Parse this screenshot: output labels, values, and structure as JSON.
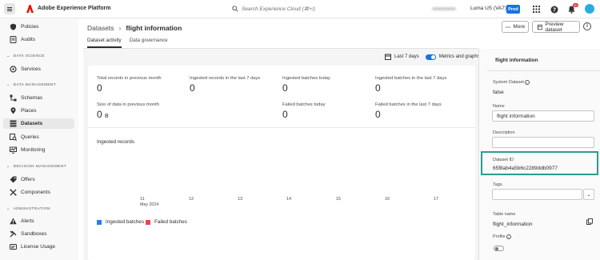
{
  "app": {
    "title": "Adobe Experience Platform"
  },
  "topbar": {
    "search_placeholder": "Search Experience Cloud (⌘+/)",
    "org": "Luma US (VA7)",
    "env_badge": "Prod",
    "notification_count": "9+",
    "colors": {
      "accent": "#1473e6",
      "badge": "#d7373f",
      "avatar": "#29abe2"
    }
  },
  "sidebar": {
    "items_top": [
      {
        "label": "Policies",
        "icon": "policies-icon"
      },
      {
        "label": "Audits",
        "icon": "audits-icon"
      }
    ],
    "sections": [
      {
        "title": "DATA SCIENCE",
        "items": [
          {
            "label": "Services",
            "icon": "services-icon"
          }
        ]
      },
      {
        "title": "DATA MANAGEMENT",
        "items": [
          {
            "label": "Schemas",
            "icon": "schemas-icon"
          },
          {
            "label": "Places",
            "icon": "places-icon"
          },
          {
            "label": "Datasets",
            "icon": "datasets-icon",
            "active": true
          },
          {
            "label": "Queries",
            "icon": "queries-icon"
          },
          {
            "label": "Monitoring",
            "icon": "monitoring-icon"
          }
        ]
      },
      {
        "title": "DECISION MANAGEMENT",
        "items": [
          {
            "label": "Offers",
            "icon": "offers-icon"
          },
          {
            "label": "Components",
            "icon": "components-icon"
          }
        ]
      },
      {
        "title": "ADMINISTRATION",
        "items": [
          {
            "label": "Alerts",
            "icon": "alerts-icon"
          },
          {
            "label": "Sandboxes",
            "icon": "sandboxes-icon"
          },
          {
            "label": "License Usage",
            "icon": "license-usage-icon"
          }
        ]
      }
    ]
  },
  "breadcrumb": {
    "parent": "Datasets",
    "current": "flight information"
  },
  "actions": {
    "more": "More",
    "preview": "Preview dataset"
  },
  "tabs": [
    {
      "label": "Dataset activity",
      "active": true
    },
    {
      "label": "Data governance",
      "active": false
    }
  ],
  "range": {
    "label": "Last 7 days",
    "toggle_label": "Metrics and graphs",
    "toggle_on": true
  },
  "metrics": {
    "total_records": {
      "label": "Total records in previous month",
      "value": "0"
    },
    "ingested_records_7d": {
      "label": "Ingested records in the last 7 days",
      "value": "0"
    },
    "ingested_batches_today": {
      "label": "Ingested batches today",
      "value": "0"
    },
    "ingested_batches_7d": {
      "label": "Ingested batches in the last 7 days",
      "value": "0"
    },
    "data_size": {
      "label": "Size of data in previous month",
      "value": "0",
      "unit": "B"
    },
    "failed_batches_today": {
      "label": "Failed batches today",
      "value": "0"
    },
    "failed_batches_7d": {
      "label": "Failed batches in the last 7 days",
      "value": "0"
    }
  },
  "chart": {
    "title": "Ingested records",
    "x_ticks": [
      "11",
      "12",
      "13",
      "14",
      "15",
      "16",
      "17"
    ],
    "x_sub": "May 2024",
    "legend": [
      {
        "label": "Ingested batches",
        "color": "#2680eb"
      },
      {
        "label": "Failed batches",
        "color": "#e34850"
      }
    ]
  },
  "panel": {
    "title": "flight information",
    "system_dataset": {
      "label": "System Dataset",
      "value": "false"
    },
    "name": {
      "label": "Name",
      "value": "flight information"
    },
    "description": {
      "label": "Description",
      "value": ""
    },
    "dataset_id": {
      "label": "Dataset ID",
      "value": "65f8ab4a5b6c2289ddb0977"
    },
    "tags": {
      "label": "Tags",
      "value": ""
    },
    "table_name": {
      "label": "Table name",
      "value": "flight_information"
    },
    "profile": {
      "label": "Profile",
      "enabled": false
    },
    "highlight_color": "#2a9d8f"
  }
}
